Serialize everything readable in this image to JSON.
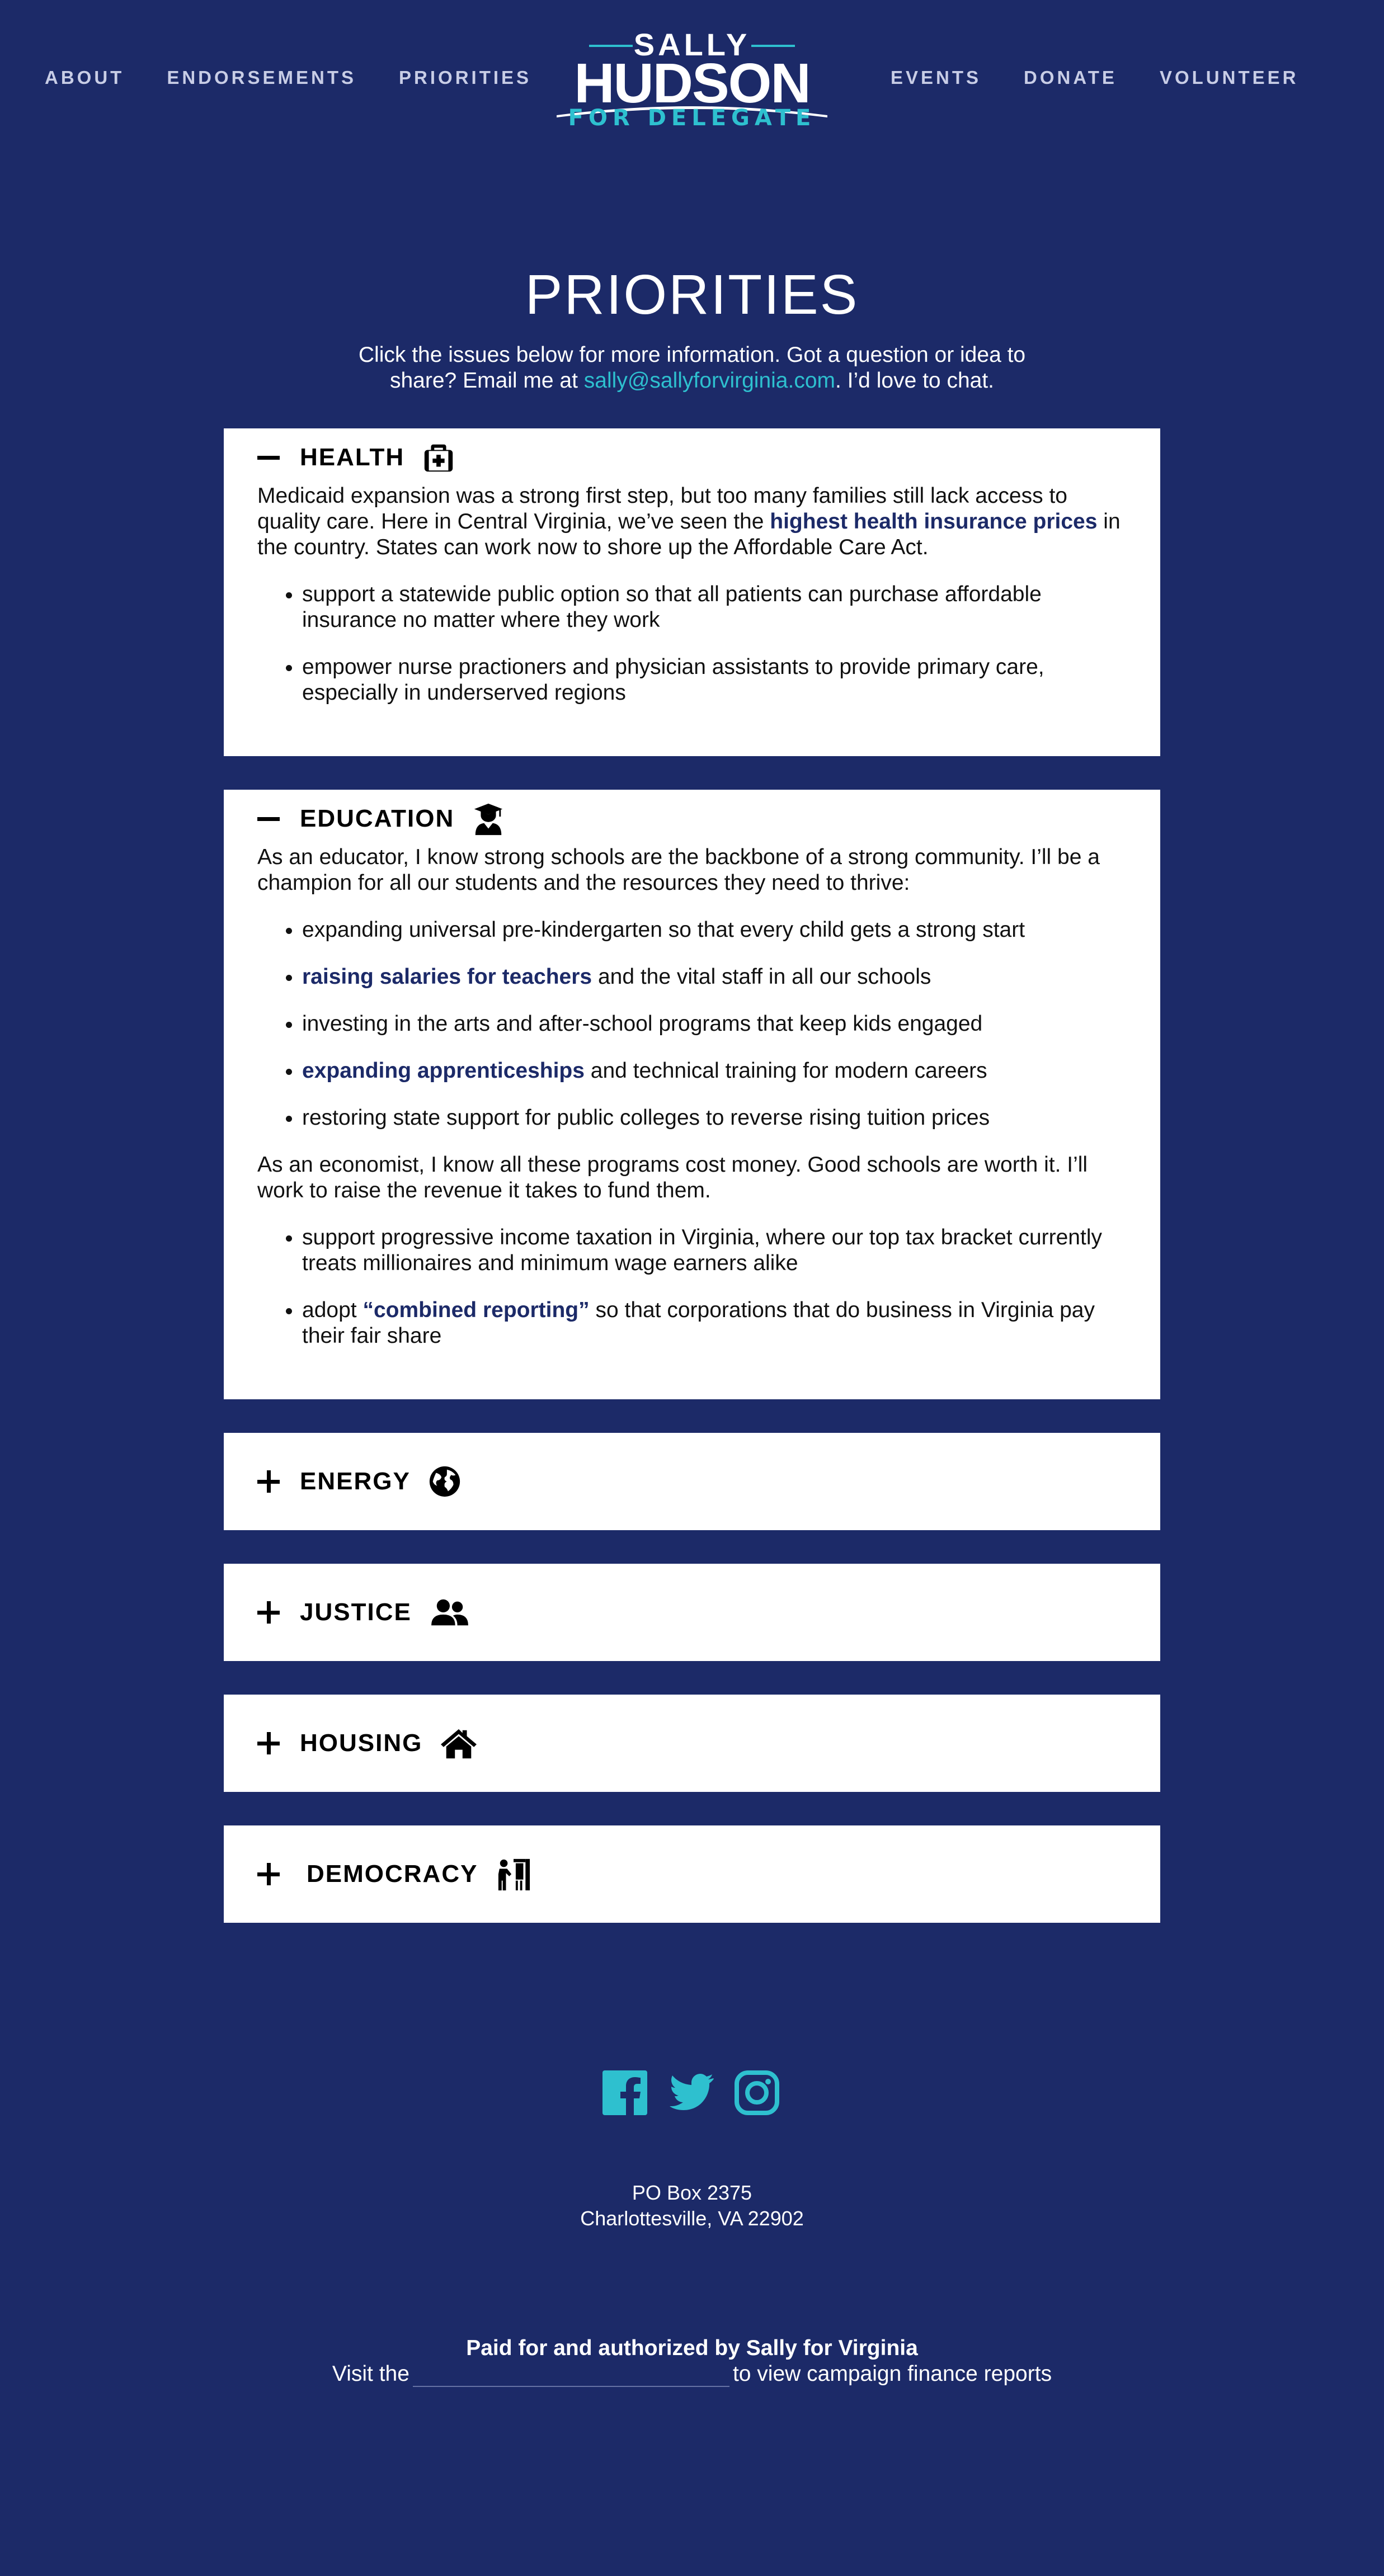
{
  "nav": {
    "left": [
      "ABOUT",
      "ENDORSEMENTS",
      "PRIORITIES"
    ],
    "right": [
      "EVENTS",
      "DONATE",
      "VOLUNTEER"
    ]
  },
  "logo": {
    "top": "SALLY",
    "name": "HUDSON",
    "sub": "FOR DELEGATE"
  },
  "page": {
    "title": "PRIORITIES",
    "intro_before": "Click the issues below for more information. Got a question or idea to share? Email me at ",
    "email": "sally@sallyforvirginia.com",
    "intro_after": ". I’d love to chat."
  },
  "colors": {
    "background": "#1c2a68",
    "accent": "#2ec0cf",
    "panel": "#ffffff",
    "link": "#1c2a68"
  },
  "panels": {
    "health": {
      "title": "HEALTH",
      "icon": "medkit-icon",
      "state": "expanded",
      "p1_a": "Medicaid expansion was a strong first step, but too many families still lack access to quality care. Here in Central Virginia, we’ve seen the ",
      "p1_link": "highest health insurance prices",
      "p1_b": " in the country. States can work now to shore up the Affordable Care Act.",
      "bullets": [
        "support a statewide public option so that all patients can purchase affordable insurance no matter where they work",
        "empower nurse practioners and physician assistants to provide primary care, especially in underserved regions"
      ]
    },
    "education": {
      "title": "EDUCATION",
      "icon": "graduate-icon",
      "state": "expanded",
      "p1": "As an educator, I know strong schools are the backbone of a strong community. I’ll be a champion for all our students and the resources they need to thrive:",
      "b1": "expanding universal pre-kindergarten so that every child gets a strong start",
      "b2_link": "raising salaries for teachers",
      "b2_rest": " and the vital staff in all our schools",
      "b3": "investing in the arts and after-school programs that keep kids engaged",
      "b4_link": "expanding apprenticeships",
      "b4_rest": " and technical training for modern careers",
      "b5": "restoring state support for public colleges to reverse rising tuition prices",
      "p2": "As an economist, I know all these programs cost money. Good schools are worth it. I’ll work to raise the revenue it takes to fund them.",
      "c1": "support progressive income taxation in Virginia, where our top tax bracket currently treats millionaires and minimum wage earners alike",
      "c2_pre": "adopt ",
      "c2_link": "“combined reporting”",
      "c2_rest": " so that corporations that do business in Virginia pay their fair share"
    },
    "energy": {
      "title": "ENERGY",
      "icon": "globe-icon",
      "state": "collapsed"
    },
    "justice": {
      "title": "JUSTICE",
      "icon": "users-icon",
      "state": "collapsed"
    },
    "housing": {
      "title": "HOUSING",
      "icon": "home-icon",
      "state": "collapsed"
    },
    "democracy": {
      "title": "DEMOCRACY",
      "icon": "voting-booth-icon",
      "state": "collapsed"
    }
  },
  "footer": {
    "socials": [
      "facebook-icon",
      "twitter-icon",
      "instagram-icon"
    ],
    "address_1": "PO Box 2375",
    "address_2": "Charlottesville, VA 22902",
    "paid_by": "Paid for and authorized by Sally for Virginia",
    "visit_before": "Visit the",
    "visit_after": "to view campaign finance reports"
  }
}
